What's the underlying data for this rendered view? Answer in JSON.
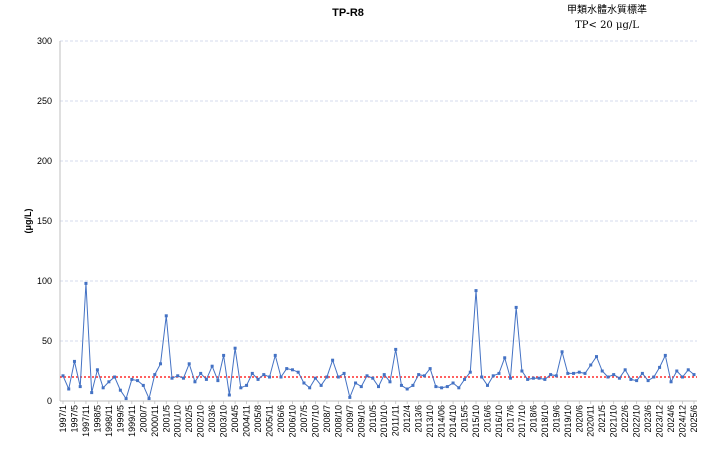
{
  "chart_data": {
    "type": "line",
    "title": "TP-R8",
    "annotation": [
      "甲類水體水質標準",
      "TP< 20 μg/L"
    ],
    "ylabel": "(μg/L)",
    "xlabel": "",
    "ylim": [
      0,
      300
    ],
    "yticks": [
      "0",
      "50",
      "100",
      "150",
      "200",
      "250",
      "300"
    ],
    "grid": "horizontal dashed",
    "legend": "none",
    "colors": {
      "series": "#4472c4",
      "standard": "#ff0000",
      "grid": "#c9cfe6",
      "axis": "#bfbfbf"
    },
    "standard_value": 20,
    "xtick_labels": [
      "1997/1",
      "1997/5",
      "1997/11",
      "1998/5",
      "1998/11",
      "1999/5",
      "1999/11",
      "2000/7",
      "2000/11",
      "2001/5",
      "2001/10",
      "2002/5",
      "2002/10",
      "2003/6",
      "2003/10",
      "2004/5",
      "2004/11",
      "2005/8",
      "2005/11",
      "2006/6",
      "2006/10",
      "2007/5",
      "2007/10",
      "2008/7",
      "2008/10",
      "2009/7",
      "2009/10",
      "2010/5",
      "2010/10",
      "2011/11",
      "2012/4",
      "2013/6",
      "2013/10",
      "2014/06",
      "2014/10",
      "2015/5",
      "2015/10",
      "2016/6",
      "2016/10",
      "2017/6",
      "2017/10",
      "2018/6",
      "2018/10",
      "2019/6",
      "2019/10",
      "2020/6",
      "2020/11",
      "2021/5",
      "2021/10",
      "2022/6",
      "2022/10",
      "2023/6",
      "2023/12",
      "2024/6",
      "2024/12",
      "2025/6"
    ],
    "series": [
      {
        "values": [
          21,
          10,
          33,
          12,
          98,
          7,
          26,
          11,
          16,
          20,
          9,
          2,
          18,
          17,
          13,
          2,
          22,
          31,
          71,
          19,
          21,
          19,
          31,
          16,
          23,
          18,
          29,
          17,
          38,
          5,
          44,
          11,
          13,
          23,
          18,
          22,
          20,
          38,
          20,
          27,
          26,
          24,
          15,
          11,
          19,
          13,
          20,
          34,
          20,
          23,
          3,
          15,
          12,
          21,
          19,
          12,
          22,
          16,
          43,
          13,
          10,
          13,
          22,
          21,
          27,
          12,
          11,
          12,
          15,
          11,
          18,
          24,
          92,
          20,
          13,
          21,
          23,
          36,
          19,
          78,
          25,
          18,
          19,
          19,
          18,
          22,
          21,
          41,
          23,
          23,
          24,
          23,
          30,
          37,
          25,
          20,
          22,
          19,
          26,
          18,
          17,
          23,
          17,
          20,
          28,
          38,
          16,
          25,
          20,
          26,
          22
        ]
      }
    ]
  }
}
